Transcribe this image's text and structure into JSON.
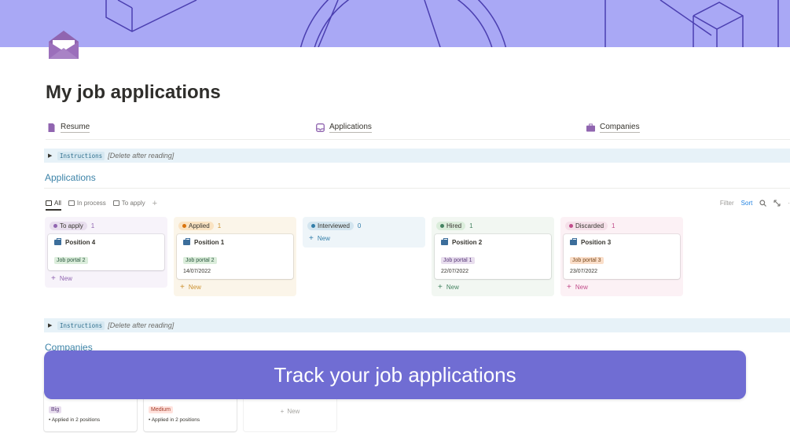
{
  "page": {
    "title": "My job applications"
  },
  "links": [
    {
      "label": "Resume",
      "icon": "document-icon",
      "color": "#9065b0"
    },
    {
      "label": "Applications",
      "icon": "inbox-icon",
      "color": "#9065b0"
    },
    {
      "label": "Companies",
      "icon": "briefcase-icon",
      "color": "#9065b0"
    }
  ],
  "instructions": {
    "code_label": "Instructions",
    "note": "[Delete after reading]"
  },
  "applications": {
    "section_title": "Applications",
    "views": [
      {
        "label": "All",
        "active": true
      },
      {
        "label": "In process",
        "active": false
      },
      {
        "label": "To apply",
        "active": false
      }
    ],
    "tools": {
      "filter": "Filter",
      "sort": "Sort"
    },
    "columns": [
      {
        "status": "To apply",
        "count": "1",
        "bg": "#f7f3fa",
        "pill_bg": "#e8deee",
        "dot": "#9065b0",
        "accent": "#9065b0",
        "cards": [
          {
            "title": "Position 4",
            "tag": "Job portal 2",
            "tag_bg": "#dbeddb",
            "tag_color": "#2b593f",
            "date": ""
          }
        ],
        "new_label": "New"
      },
      {
        "status": "Applied",
        "count": "1",
        "bg": "#fbf5e9",
        "pill_bg": "#fae3c2",
        "dot": "#d9730d",
        "accent": "#cb912f",
        "cards": [
          {
            "title": "Position 1",
            "tag": "Job portal 2",
            "tag_bg": "#dbeddb",
            "tag_color": "#2b593f",
            "date": "14/07/2022"
          }
        ],
        "new_label": "New"
      },
      {
        "status": "Interviewed",
        "count": "0",
        "bg": "#eef5f9",
        "pill_bg": "#d3e5ef",
        "dot": "#337ea9",
        "accent": "#337ea9",
        "cards": [],
        "new_label": "New"
      },
      {
        "status": "Hired",
        "count": "1",
        "bg": "#f2f7f2",
        "pill_bg": "#dbeddb",
        "dot": "#448361",
        "accent": "#448361",
        "cards": [
          {
            "title": "Position 2",
            "tag": "Job portal 1",
            "tag_bg": "#e8deee",
            "tag_color": "#5a3a7a",
            "date": "22/07/2022"
          }
        ],
        "new_label": "New"
      },
      {
        "status": "Discarded",
        "count": "1",
        "bg": "#fcf1f5",
        "pill_bg": "#f5e0e9",
        "dot": "#c14c8a",
        "accent": "#c14c8a",
        "cards": [
          {
            "title": "Position 3",
            "tag": "Job portal 3",
            "tag_bg": "#fadec9",
            "tag_color": "#7a4a1e",
            "date": "23/07/2022"
          }
        ],
        "new_label": "New"
      }
    ]
  },
  "companies": {
    "section_title": "Companies",
    "cards": [
      {
        "size": "Big",
        "size_bg": "#e8deee",
        "size_color": "#5a3a7a",
        "line": "• Applied in 2 positions"
      },
      {
        "size": "Medium",
        "size_bg": "#ffe2dd",
        "size_color": "#a33d2a",
        "line": "• Applied in 2 positions"
      }
    ],
    "new_label": "New"
  },
  "overlay": {
    "text": "Track your job applications"
  },
  "colors": {
    "banner": "#a9a8f5",
    "banner_lines": "#4b3fb0",
    "section_title": "#3c83a8",
    "overlay": "#706dd3"
  }
}
